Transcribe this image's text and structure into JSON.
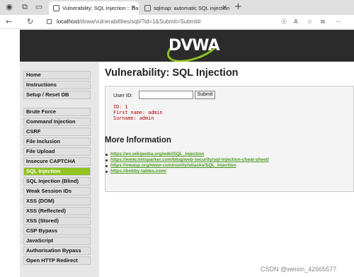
{
  "browser": {
    "tabs": [
      {
        "title": "Vulnerability: SQL Injection :: Da",
        "active": true
      },
      {
        "title": "sqlmap: automatic SQL injection",
        "active": false
      }
    ],
    "close_glyph": "×",
    "new_tab_glyph": "+",
    "url_host": "localhost",
    "url_path": "/dvwa/vulnerabilities/sqli/?id=1&Submit=Submit#",
    "icons": [
      "back-icon",
      "refresh-icon",
      "lock-icon",
      "reader-icon",
      "font-size-icon",
      "favorite-icon",
      "collections-icon"
    ]
  },
  "header": {
    "logo_text": "DVWA"
  },
  "menu": {
    "items": [
      "Home",
      "Instructions",
      "Setup / Reset DB",
      "Brute Force",
      "Command Injection",
      "CSRF",
      "File Inclusion",
      "File Upload",
      "Insecure CAPTCHA",
      "SQL Injection",
      "SQL Injection (Blind)",
      "Weak Session IDs",
      "XSS (DOM)",
      "XSS (Reflected)",
      "XSS (Stored)",
      "CSP Bypass",
      "JavaScript",
      "Authorisation Bypass",
      "Open HTTP Redirect"
    ],
    "active": "SQL Injection"
  },
  "main": {
    "title": "Vulnerability: SQL Injection",
    "form": {
      "label": "User ID:",
      "value": "",
      "submit_label": "Submit"
    },
    "result_lines": [
      "ID: 1",
      "First name: admin",
      "Surname: admin"
    ],
    "more_info_title": "More Information",
    "links": [
      "https://en.wikipedia.org/wiki/SQL_injection",
      "https://www.netsparker.com/blog/web-security/sql-injection-cheat-sheet/",
      "https://owasp.org/www-community/attacks/SQL_Injection",
      "https://bobby-tables.com/"
    ]
  },
  "watermark": "CSDN @weixin_42665577",
  "colors": {
    "accent": "#8fc31f",
    "header_bg": "#2b2b2b",
    "result_text": "#b00000",
    "link": "#4a9a1e"
  }
}
